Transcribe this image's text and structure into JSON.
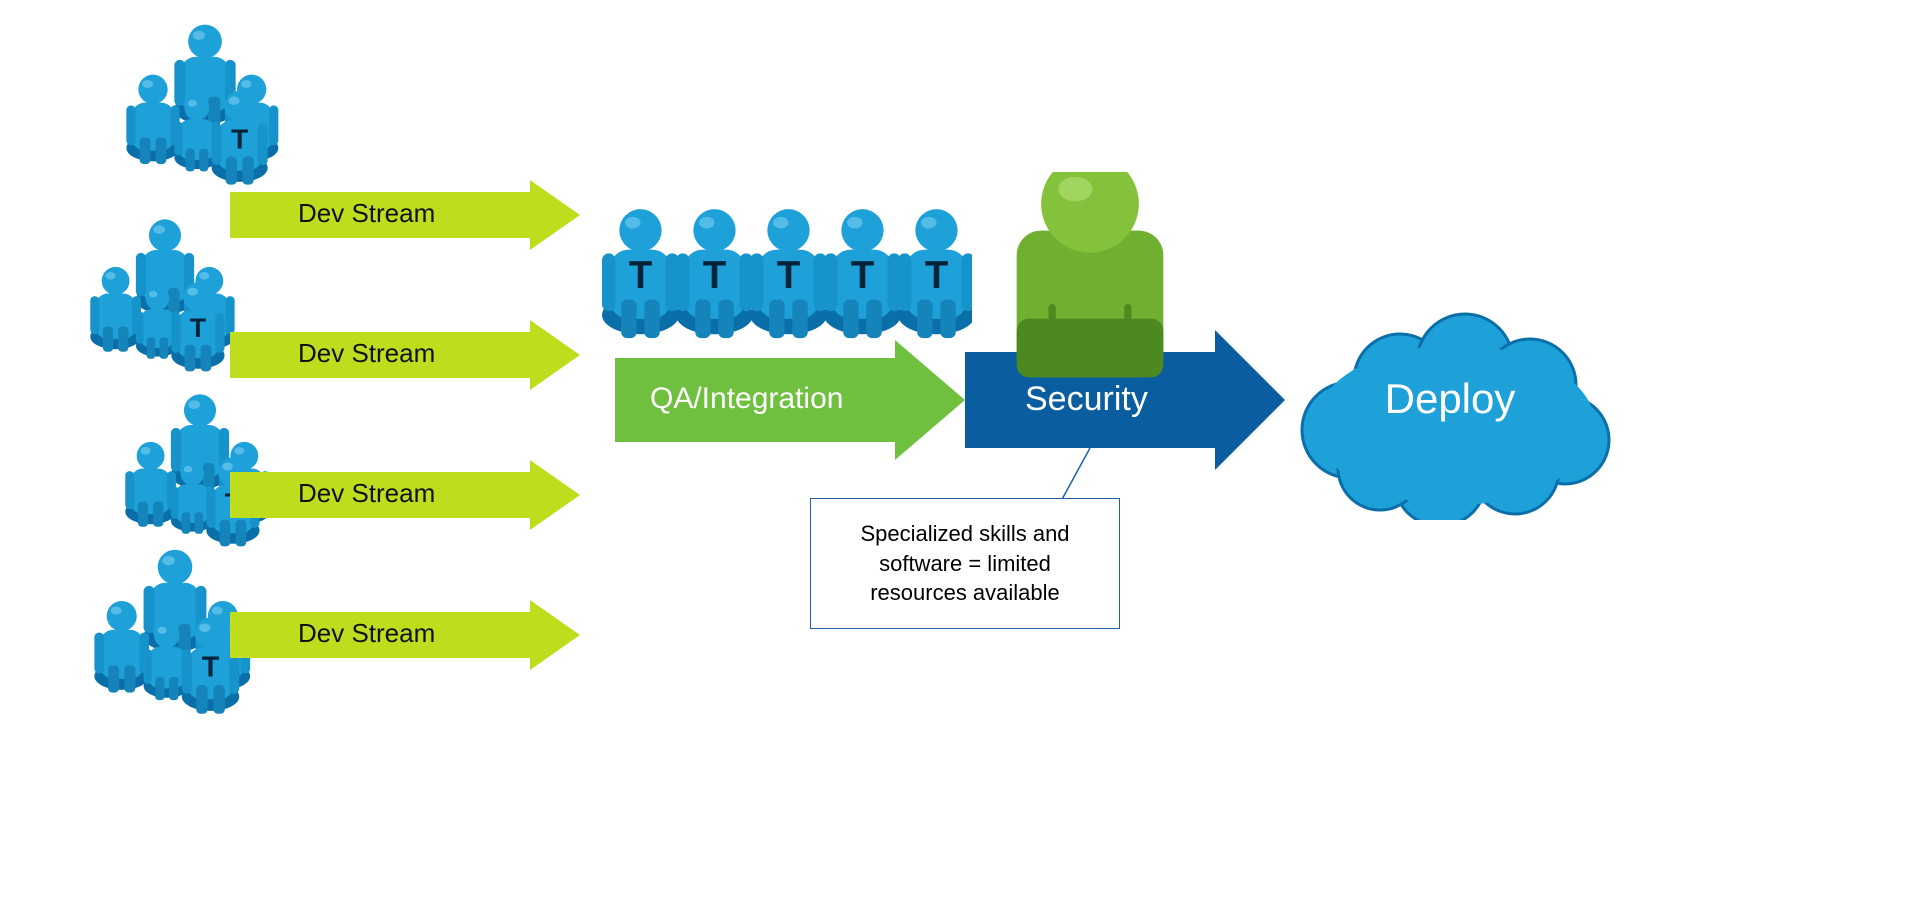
{
  "arrows": {
    "dev1": "Dev Stream",
    "dev2": "Dev Stream",
    "dev3": "Dev Stream",
    "dev4": "Dev Stream",
    "qa": "QA/Integration",
    "security": "Security"
  },
  "callout": "Specialized skills and software = limited resources available",
  "deploy": "Deploy",
  "colors": {
    "devArrow": "#c0dd1d",
    "qaArrow": "#70c040",
    "secArrow": "#0a5d9e",
    "blue": "#1ea0d9",
    "blueDark": "#0a6fa8",
    "green": "#70b030",
    "greenDark": "#4c8a20",
    "greenHead": "#6fb52d"
  },
  "meta": {
    "description": "Pipeline diagram: four Dev Stream teams feed into QA/Integration, then a Security gate (limited specialized resources), then Deploy.",
    "devTeams": 4,
    "qaTesters": 5,
    "securityPeople": 1
  }
}
